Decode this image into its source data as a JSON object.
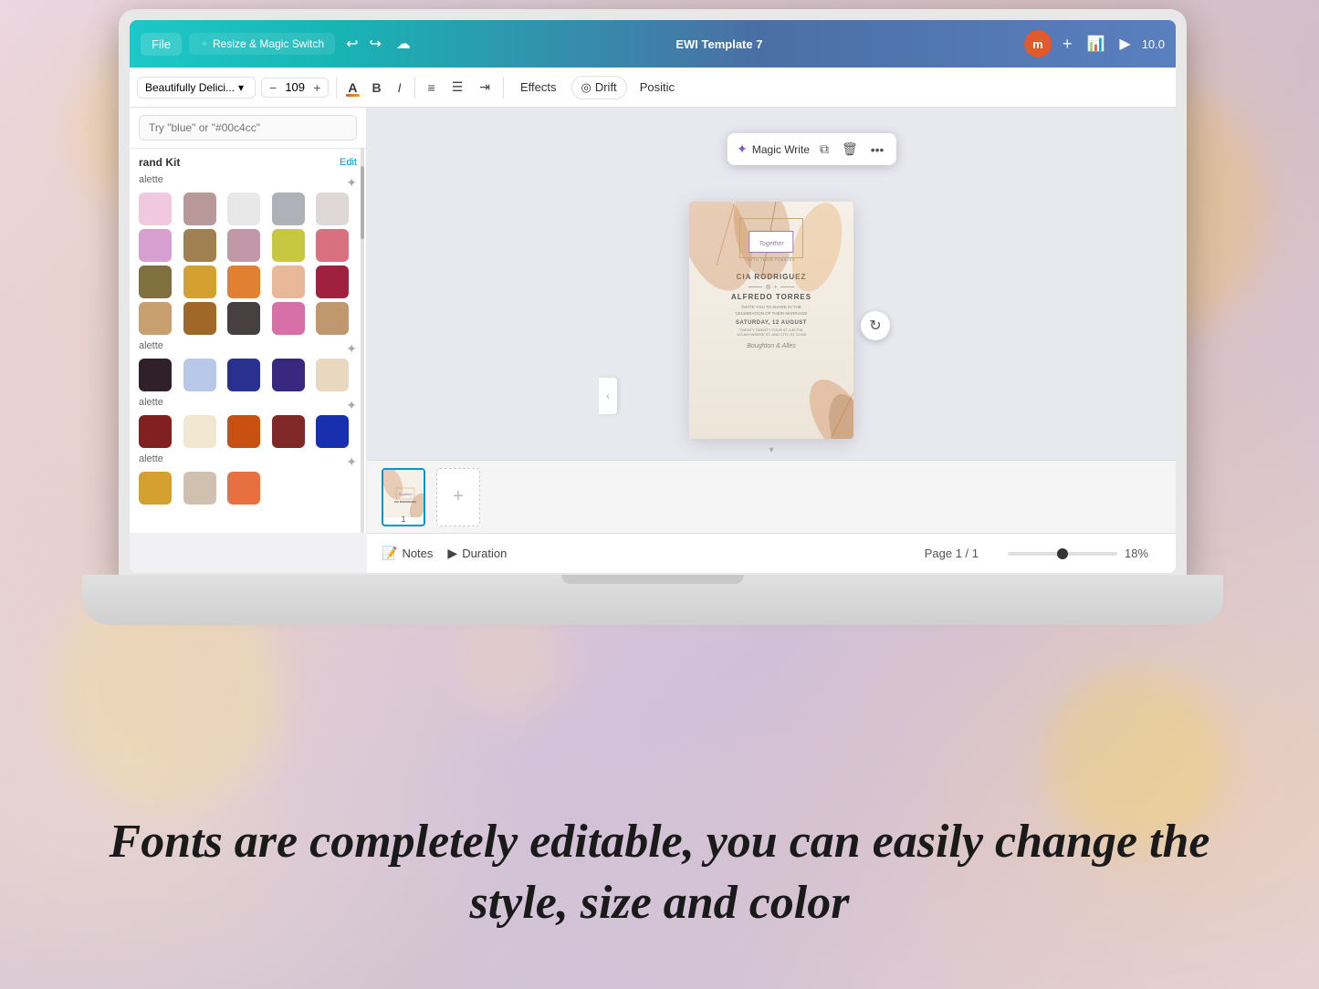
{
  "background": {
    "colors": [
      "#e8d5e8",
      "#d4c5d9",
      "#c8bcd4"
    ]
  },
  "header": {
    "file_label": "File",
    "resize_label": "Resize & Magic Switch",
    "title": "EWI Template 7",
    "avatar_letter": "m",
    "effects_label": "Effects",
    "drift_label": "Drift",
    "position_label": "Positic"
  },
  "toolbar": {
    "font_name": "Beautifully Delici...",
    "font_size": "109",
    "bold_label": "B",
    "italic_label": "I",
    "effects_label": "Effects",
    "drift_label": "Drift",
    "position_label": "Position"
  },
  "left_panel": {
    "search_placeholder": "Try \"blue\" or \"#00c4cc\"",
    "brand_kit_label": "rand Kit",
    "edit_label": "Edit",
    "palette_label": "alette",
    "color_rows": [
      [
        "#f0c8e0",
        "#b89898",
        "#e8e8e8",
        "#b0b0b8",
        "#e0d8d8"
      ],
      [
        "#d8a0d0",
        "#a08050",
        "#c098a8",
        "#c0c840",
        "#d87080"
      ],
      [
        "#807040",
        "#d4a030",
        "#e08030",
        "#e8b898",
        "#a02040"
      ],
      [
        "#c8a070",
        "#a06828",
        "#484040",
        "#d870a8",
        "#c09870"
      ]
    ],
    "swatches_row2": [
      "#302028",
      "#b8c8e8",
      "#283090",
      "#382880",
      "#e8d8c0"
    ],
    "swatches_row3": [
      "#802020",
      "#f0e8d0",
      "#c85010",
      "#802828",
      "#1830b0"
    ]
  },
  "floating_toolbar": {
    "magic_write_label": "Magic Write"
  },
  "design_card": {
    "together_label": "Together",
    "name1": "CIA RODRIGUEZ",
    "name2": "ALFREDO TORRES",
    "invite_text": "INVITE YOU TO SHARE IN THE\nCELEBRATION OF THEIR MARRIAGE",
    "date_text": "SATURDAY, 12 AUGUST",
    "detail_text": "TWENTY TWENTY FOUR AT 4:30 P.M.",
    "venue_text": "123 ANYWHERE ST. AND CITY, ST 12345",
    "script_text": "Boughton & Alles"
  },
  "thumbnails": {
    "page_num": "1",
    "add_label": "+"
  },
  "status_bar": {
    "notes_label": "Notes",
    "duration_label": "Duration",
    "page_label": "Page 1 / 1",
    "zoom_value": "18%"
  },
  "bottom_text": {
    "line1": "Fonts are completely editable, you can easily change the",
    "line2": "style, size and color"
  }
}
